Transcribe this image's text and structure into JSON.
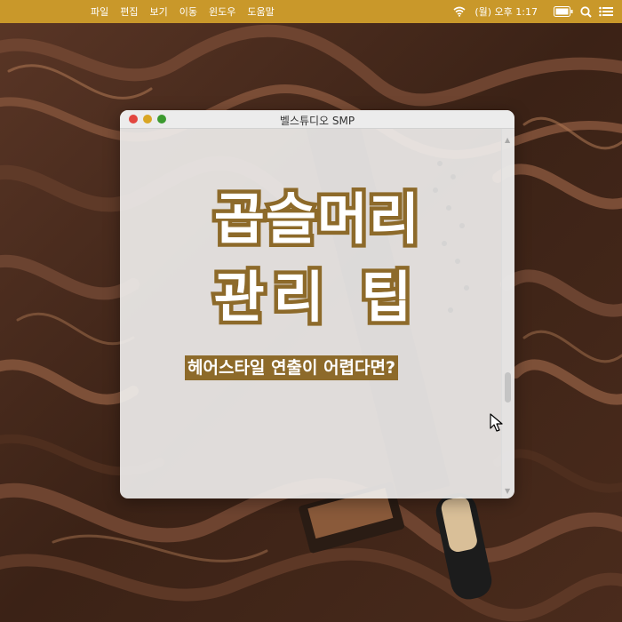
{
  "menubar": {
    "menus": [
      "파일",
      "편집",
      "보기",
      "이동",
      "윈도우",
      "도움말"
    ],
    "clock": "(월) 오후 1:17"
  },
  "window": {
    "title": "벨스튜디오 SMP",
    "headline_line1": "곱슬머리",
    "headline_line2": "관리 팁",
    "subtitle": "헤어스타일 연출이 어렵다면?"
  },
  "colors": {
    "menubar": "#c9982a",
    "accent_brown": "#8d6a2a",
    "close": "#e2463f",
    "minimize": "#d9a624",
    "maximize": "#3c9a2f"
  },
  "icons": [
    "wifi-icon",
    "battery-icon",
    "search-icon",
    "list-icon",
    "mouse-cursor-icon"
  ]
}
